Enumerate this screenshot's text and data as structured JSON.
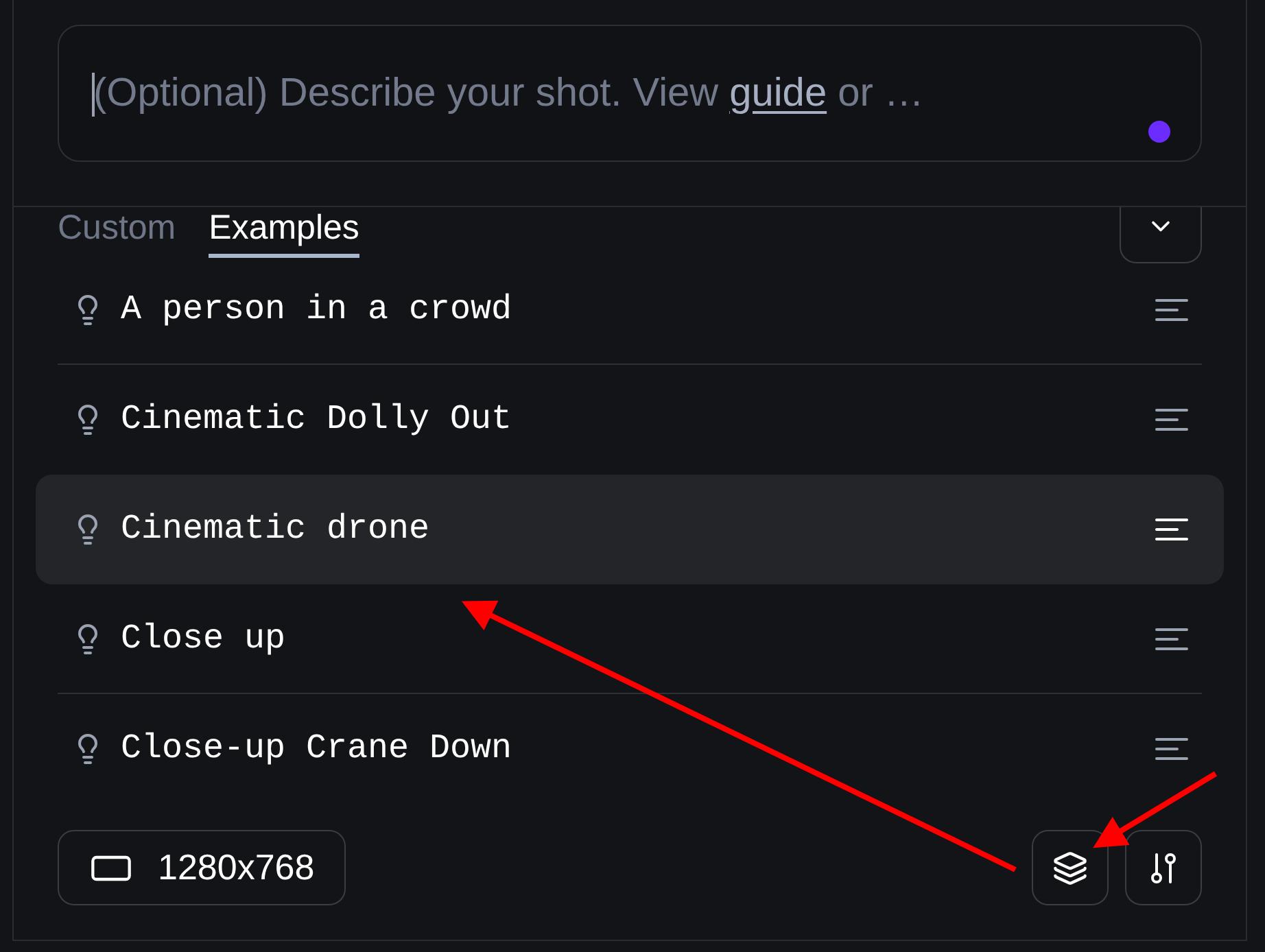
{
  "prompt": {
    "placeholder": "(Optional) Describe your shot. View",
    "link": "guide",
    "placeholder_end": "or …"
  },
  "tabs": [
    {
      "label": "Custom",
      "selected": false
    },
    {
      "label": "Examples",
      "selected": true
    }
  ],
  "examples": [
    {
      "label": "A person in a crowd",
      "selected": false
    },
    {
      "label": "Cinematic Dolly Out",
      "selected": false
    },
    {
      "label": "Cinematic drone",
      "selected": true
    },
    {
      "label": "Close up",
      "selected": false
    },
    {
      "label": "Close-up Crane Down",
      "selected": false
    }
  ],
  "resolution": "1280x768"
}
